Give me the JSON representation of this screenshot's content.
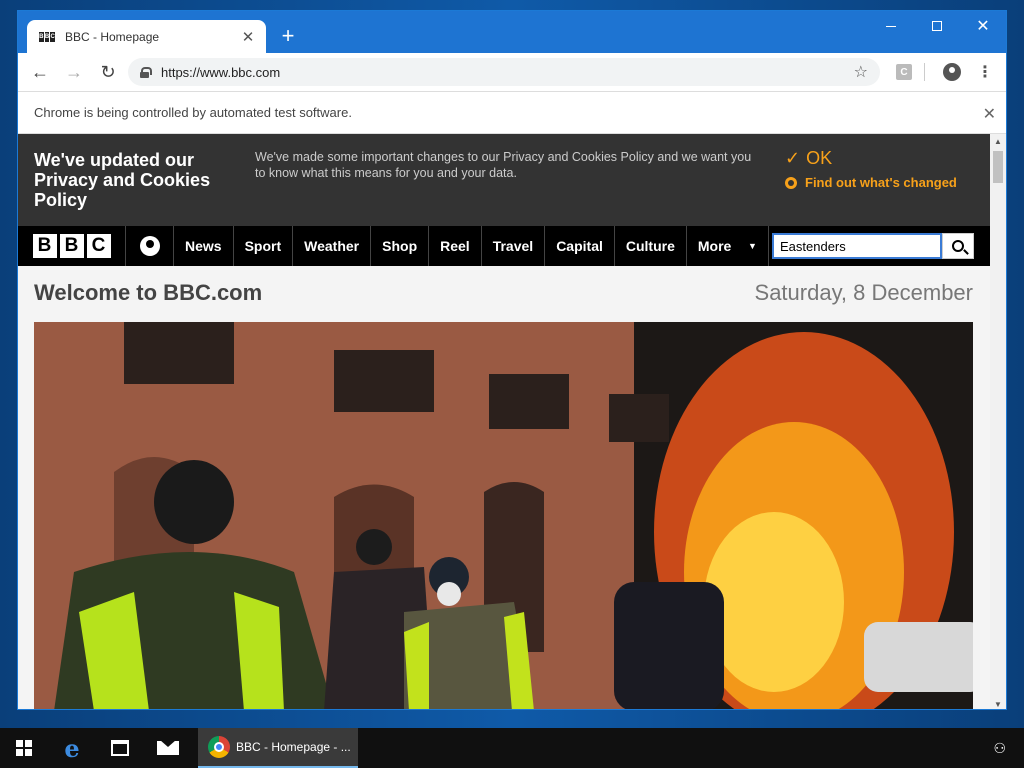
{
  "browser": {
    "tab_title": "BBC - Homepage",
    "tab_favicon_letters": [
      "B",
      "B",
      "C"
    ],
    "url": "https://www.bbc.com",
    "extension_badge": "C",
    "infobar_text": "Chrome is being controlled by automated test software."
  },
  "cookie_banner": {
    "title": "We've updated our Privacy and Cookies Policy",
    "body": "We've made some important changes to our Privacy and Cookies Policy and we want you to know what this means for you and your data.",
    "ok_label": "OK",
    "link_label": "Find out what's changed",
    "accent_color": "#f7a11a"
  },
  "bbc_nav": {
    "logo_letters": [
      "B",
      "B",
      "C"
    ],
    "items": [
      {
        "label": "News"
      },
      {
        "label": "Sport"
      },
      {
        "label": "Weather"
      },
      {
        "label": "Shop"
      },
      {
        "label": "Reel"
      },
      {
        "label": "Travel"
      },
      {
        "label": "Capital"
      },
      {
        "label": "Culture"
      }
    ],
    "more_label": "More",
    "search_value": "Eastenders"
  },
  "page": {
    "welcome_title": "Welcome to BBC.com",
    "date": "Saturday, 8 December"
  },
  "taskbar": {
    "chrome_label": "BBC - Homepage - ..."
  }
}
